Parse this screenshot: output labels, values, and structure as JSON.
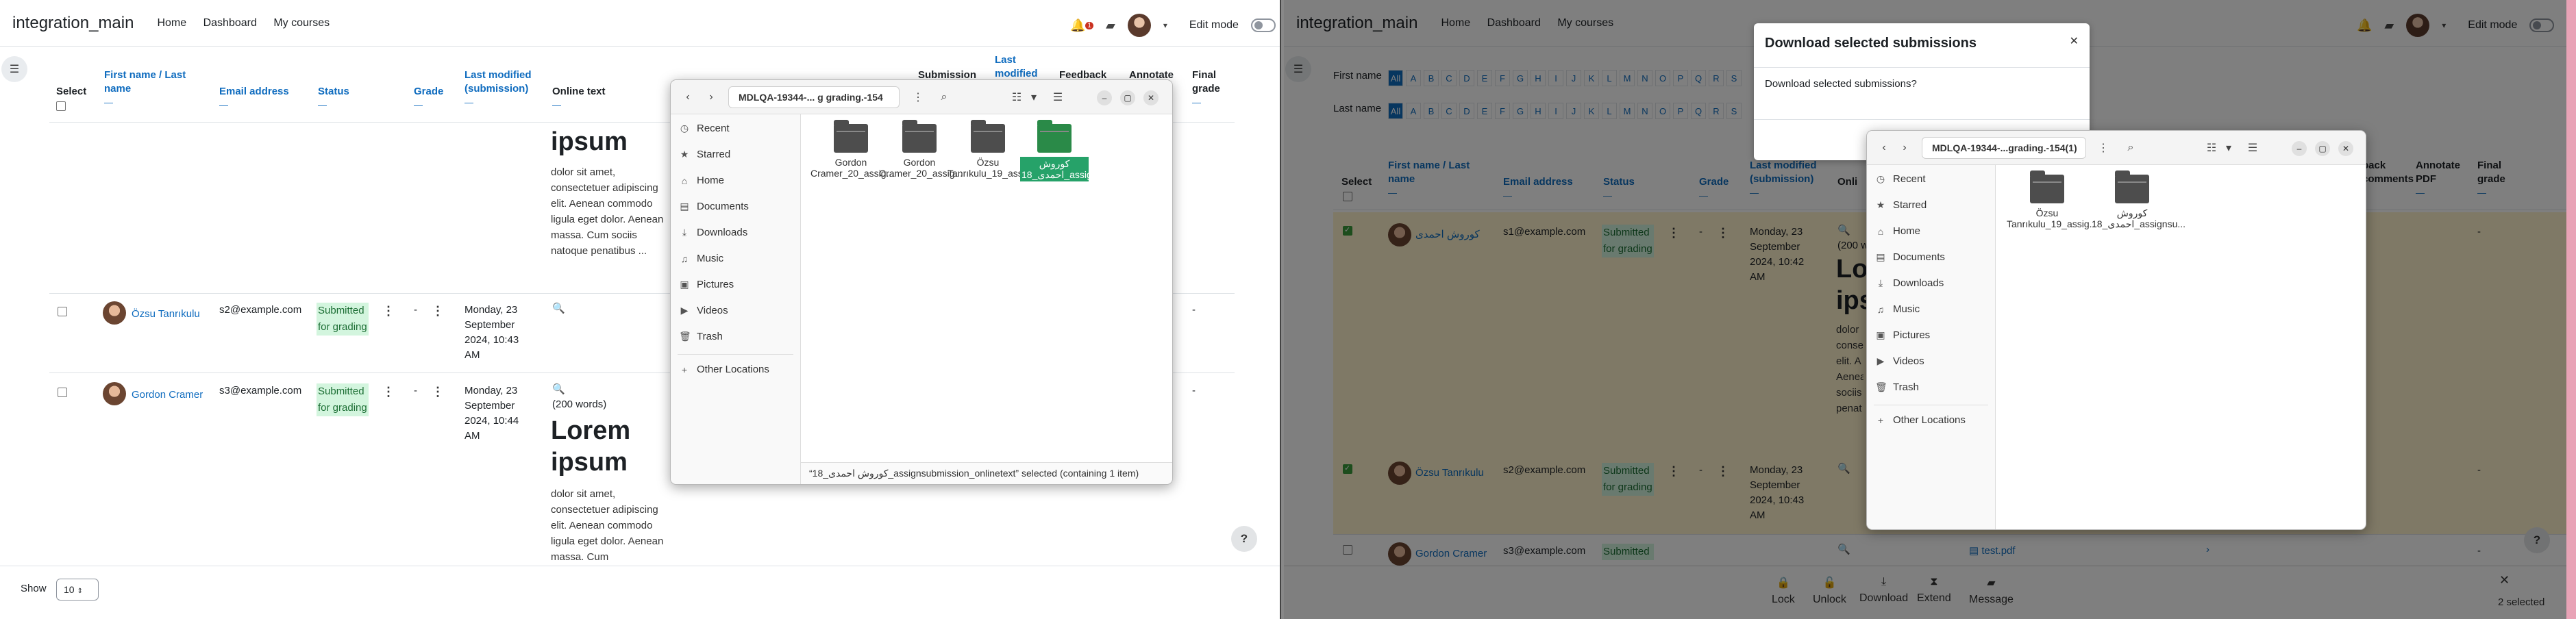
{
  "left": {
    "site_name": "integration_main",
    "nav": {
      "home": "Home",
      "dashboard": "Dashboard",
      "mycourses": "My courses"
    },
    "edit_mode": "Edit mode",
    "notif_count": "1",
    "headers": {
      "select": "Select",
      "first_last": "First name / Last name",
      "email": "Email address",
      "status": "Status",
      "grade": "Grade",
      "last_modified": "Last modified (submission)",
      "online_text": "Online text",
      "submission": "Submission",
      "last_mod_short": "Last modified",
      "feedback": "Feedback",
      "annotate": "Annotate",
      "final_grade": "Final grade"
    },
    "row1": {
      "big": "ipsum",
      "para": "dolor sit amet, consectetuer adipiscing elit. Aenean commodo ligula eget dolor. Aenean massa. Cum sociis natoque penatibus ..."
    },
    "row2": {
      "name": "Özsu Tanrıkulu",
      "email": "s2@example.com",
      "status": "Submitted for grading",
      "grade": "-",
      "date": "Monday, 23 September 2024, 10:43 AM",
      "final": "-"
    },
    "row3": {
      "name": "Gordon Cramer",
      "email": "s3@example.com",
      "status": "Submitted for grading",
      "grade": "-",
      "date": "Monday, 23 September 2024, 10:44 AM",
      "words": "(200 words)",
      "big": "Lorem ipsum",
      "para": "dolor sit amet, consectetuer adipiscing elit. Aenean commodo ligula eget dolor. Aenean massa. Cum",
      "final": "-"
    },
    "show_label": "Show",
    "show_value": "10",
    "filemanager": {
      "path": "MDLQA-19344-... g grading.-154",
      "sidebar": [
        "Recent",
        "Starred",
        "Home",
        "Documents",
        "Downloads",
        "Music",
        "Pictures",
        "Videos",
        "Trash",
        "Other Locations"
      ],
      "folders": [
        {
          "label": "Gordon Cramer_20_assig..."
        },
        {
          "label": "Gordon Cramer_20_assig..."
        },
        {
          "label": "Özsu Tanrıkulu_19_assig..."
        },
        {
          "label": "کوروش احمدی_18_assignsubmission_onlinetext"
        }
      ],
      "status": "“کوروش احمدی_18_assignsubmission_onlinetext” selected (containing 1 item)"
    }
  },
  "right": {
    "site_name": "integration_main",
    "nav": {
      "home": "Home",
      "dashboard": "Dashboard",
      "mycourses": "My courses"
    },
    "edit_mode": "Edit mode",
    "first_name_label": "First name",
    "last_name_label": "Last name",
    "letters": [
      "All",
      "A",
      "B",
      "C",
      "D",
      "E",
      "F",
      "G",
      "H",
      "I",
      "J",
      "K",
      "L",
      "M",
      "N",
      "O",
      "P",
      "Q",
      "R",
      "S"
    ],
    "modal": {
      "title": "Download selected submissions",
      "body": "Download selected submissions?"
    },
    "headers": {
      "select": "Select",
      "first_last": "First name / Last name",
      "email": "Email address",
      "status": "Status",
      "grade": "Grade",
      "last_modified": "Last modified (submission)",
      "online": "Onli",
      "feedback_comments": "back comments",
      "annotate": "Annotate PDF",
      "final_grade": "Final grade"
    },
    "row1": {
      "name": "کوروش احمدی",
      "email": "s1@example.com",
      "status": "Submitted for grading",
      "grade": "-",
      "date": "Monday, 23 September 2024, 10:42 AM",
      "words": "(200 w",
      "big1": "Lo",
      "big2": "ips",
      "para": "dolor conse elit. A Aenea sociis penat",
      "final": "-"
    },
    "row2": {
      "name": "Özsu Tanrıkulu",
      "email": "s2@example.com",
      "status": "Submitted for grading",
      "grade": "-",
      "date": "Monday, 23 September 2024, 10:43 AM",
      "final": "-"
    },
    "row3": {
      "name": "Gordon Cramer",
      "email": "s3@example.com",
      "status": "Submitted",
      "file": "test.pdf",
      "final": "-"
    },
    "filemanager": {
      "path": "MDLQA-19344-...grading.-154(1)",
      "sidebar": [
        "Recent",
        "Starred",
        "Home",
        "Documents",
        "Downloads",
        "Music",
        "Pictures",
        "Videos",
        "Trash",
        "Other Locations"
      ],
      "folders": [
        {
          "label": "Özsu Tanrıkulu_19_assig..."
        },
        {
          "label": "کوروش احمدی_18_assignsu..."
        }
      ]
    },
    "bulk": {
      "lock": "Lock",
      "unlock": "Unlock",
      "download": "Download",
      "extend": "Extend",
      "message": "Message",
      "selected": "2 selected"
    }
  }
}
